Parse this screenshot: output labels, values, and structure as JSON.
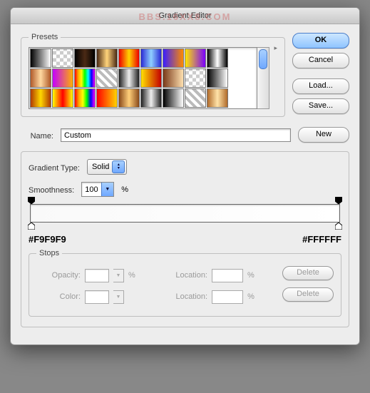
{
  "title": "Gradient Editor",
  "watermark": "BBS.16XX8.COM",
  "buttons": {
    "ok": "OK",
    "cancel": "Cancel",
    "load": "Load...",
    "save": "Save...",
    "new": "New",
    "delete": "Delete"
  },
  "presets": {
    "label": "Presets",
    "swatches": [
      "linear-gradient(90deg,#000,#fff)",
      "repeating-conic-gradient(#ccc 0 25%,#fff 0 50%) 0/10px 10px",
      "linear-gradient(90deg,#000,#4b2a15,#000)",
      "linear-gradient(90deg,#4b2a15,#ffd37a,#4b2a15)",
      "linear-gradient(90deg,#e00,#ffd400,#e00)",
      "linear-gradient(90deg,#2a2ad6,#8fd0ff,#2a2ad6)",
      "linear-gradient(90deg,#3a1fff,#ff8a00)",
      "linear-gradient(90deg,#ffe600,#7a00ff)",
      "linear-gradient(90deg,#000,#fff,#000)",
      "linear-gradient(90deg,#b15a2a,#ffd9a0,#b15a2a)",
      "linear-gradient(90deg,#c400ff,#ffb000)",
      "linear-gradient(90deg,red,orange,yellow,#0f0,#0ff,blue,#f0f)",
      "repeating-linear-gradient(45deg,#bbb 0 4px,#fff 4px 8px)",
      "linear-gradient(90deg,#222,#eee,#222)",
      "linear-gradient(90deg,#ffe100,#c40000)",
      "linear-gradient(90deg,#7a3a1a,#ffe1b0)",
      "repeating-conic-gradient(#ccc 0 25%,#fff 0 50%) 0/10px 10px",
      "linear-gradient(90deg,#000,#fff)",
      "linear-gradient(90deg,#b03a00,#ffd800,#b03a00)",
      "linear-gradient(90deg,#ff0,#f00,#ff0)",
      "linear-gradient(90deg,red,orange,yellow,#0f0,blue,#f0f)",
      "linear-gradient(90deg,#ff0000,#ffd400)",
      "linear-gradient(90deg,#8a4a1a,#ffcf7a,#8a4a1a)",
      "linear-gradient(90deg,#222,#eee,#222)",
      "linear-gradient(90deg,#000,#fff)",
      "repeating-linear-gradient(45deg,#bbb 0 4px,#fff 4px 8px)",
      "linear-gradient(90deg,#b06a2a,#ffe3a8,#b06a2a)"
    ]
  },
  "name": {
    "label": "Name:",
    "value": "Custom"
  },
  "gradientType": {
    "label": "Gradient Type:",
    "value": "Solid"
  },
  "smoothness": {
    "label": "Smoothness:",
    "value": "100",
    "unit": "%"
  },
  "colorStops": {
    "left": "#F9F9F9",
    "right": "#FFFFFF"
  },
  "stops": {
    "label": "Stops",
    "opacity": {
      "label": "Opacity:",
      "value": "",
      "unit": "%"
    },
    "color": {
      "label": "Color:"
    },
    "location": {
      "label": "Location:",
      "value": "",
      "unit": "%"
    }
  }
}
